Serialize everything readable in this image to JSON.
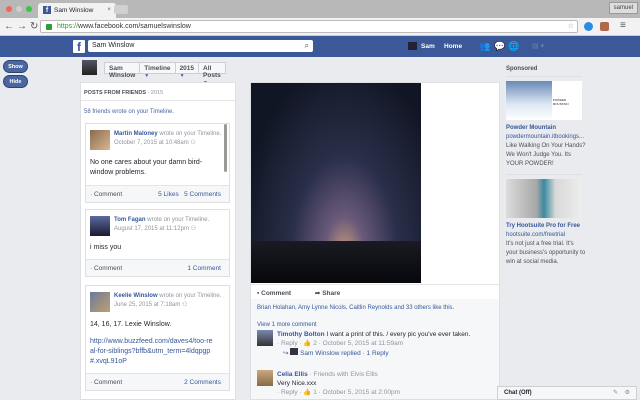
{
  "browser": {
    "tab_title": "Sam Winslow",
    "profile": "samuel",
    "url_scheme": "https://",
    "url_rest": "www.facebook.com/samuelswinslow"
  },
  "fb": {
    "search_value": "Sam Winslow",
    "user": "Sam",
    "home": "Home"
  },
  "sidebar": {
    "show": "Show",
    "hide": "Hide"
  },
  "selector": {
    "name": "Sam Winslow",
    "view": "Timeline",
    "year": "2015",
    "filter": "All Posts"
  },
  "left": {
    "header": "POSTS FROM FRIENDS",
    "header_year": "· 2015",
    "summary": "58 friends wrote on your Timeline.",
    "posts": [
      {
        "author": "Martin Maloney",
        "action": "wrote on your Timeline.",
        "time": "October 7, 2015 at 10:48am",
        "body": "No one cares about your damn bird-window problems.",
        "comment": "· Comment",
        "likes": "5 Likes",
        "comments": "5 Comments"
      },
      {
        "author": "Tom Fagan",
        "action": "wrote on your Timeline.",
        "time": "August 17, 2015 at 11:12pm",
        "body": "i miss you",
        "comment": "· Comment",
        "comments": "1 Comment"
      },
      {
        "author": "Keelie Winslow",
        "action": "wrote on your Timeline.",
        "time": "June 25, 2015 at 7:18am",
        "body": "14, 16, 17. Lexie Winslow.",
        "link": "http://www.buzzfeed.com/daves4/too-real-for-siblings?bffb&utm_term=4ldqpgp#.xvqL91oP",
        "comment": "· Comment",
        "comments": "2 Comments"
      }
    ]
  },
  "center": {
    "comment": "Comment",
    "share": "Share",
    "likes": "Brian Holahan, Amy Lynne Nicols, Caitlin Reynolds and 33 others like this.",
    "view_more": "View 1 more comment",
    "comments": [
      {
        "author": "Timothy Bolton",
        "text": "I want a print of this. / every pic you've ever taken.",
        "meta": "· Reply · 👍 2 · October 5, 2015 at 11:59am",
        "reply": "Sam Winslow replied · 1 Reply"
      },
      {
        "author": "Celia Ellis",
        "context": "· Friends with Elvis Ellis",
        "text": "Very Nice.xxx",
        "meta": "· Reply · 👍 1 · October 5, 2015 at 2:00pm"
      }
    ]
  },
  "ads": {
    "label": "Sponsored",
    "items": [
      {
        "title": "Powder Mountain",
        "domain": "powdermountain.itbookings...",
        "text": "Like Walking On Your Hands? We Won't Judge You. Its YOUR POWDER!",
        "logo": "POWDER MOUNTAIN"
      },
      {
        "title": "Try Hootsuite Pro for Free",
        "domain": "hootsuite.com/freetrial",
        "text": "It's not just a free trial. It's your business's opportunity to win at social media."
      }
    ]
  },
  "chat": {
    "label": "Chat (Off)"
  }
}
